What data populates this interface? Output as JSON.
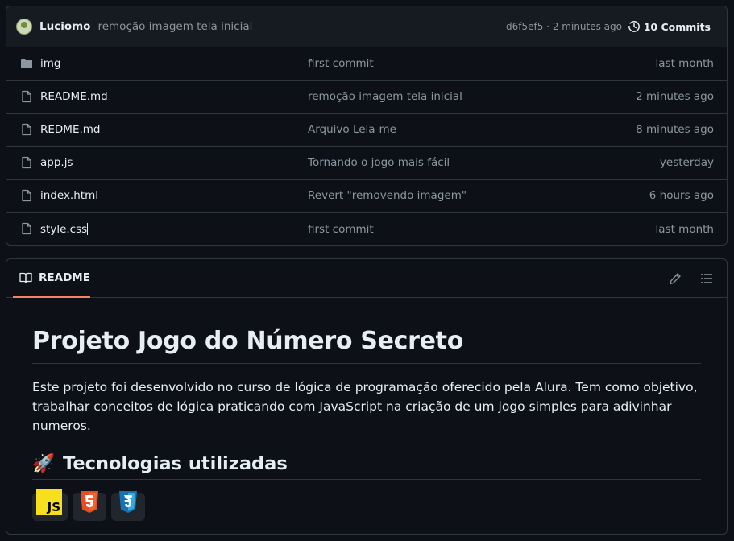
{
  "commit_bar": {
    "author": "Luciomo",
    "message": "remoção imagem tela inicial",
    "sha_time": "d6f5ef5 · 2 minutes ago",
    "commits_label": "10 Commits",
    "icons": [
      "avatar",
      "history-icon"
    ]
  },
  "files": [
    {
      "name": "img",
      "icon": "folder-icon",
      "commit": "first commit",
      "date": "last month"
    },
    {
      "name": "README.md",
      "icon": "file-icon",
      "commit": "remoção imagem tela inicial",
      "date": "2 minutes ago"
    },
    {
      "name": "REDME.md",
      "icon": "file-icon",
      "commit": "Arquivo Leia-me",
      "date": "8 minutes ago"
    },
    {
      "name": "app.js",
      "icon": "file-icon",
      "commit": "Tornando o jogo mais fácil",
      "date": "yesterday"
    },
    {
      "name": "index.html",
      "icon": "file-icon",
      "commit": "Revert \"removendo imagem\"",
      "date": "6 hours ago"
    },
    {
      "name": "style.css",
      "icon": "file-icon",
      "commit": "first commit",
      "date": "last month"
    }
  ],
  "readme": {
    "tab_label": "README",
    "title": "Projeto Jogo do Número Secreto",
    "description": "Este projeto foi desenvolvido no curso de lógica de programação oferecido pela Alura. Tem como objetivo, trabalhar conceitos de lógica praticando com JavaScript na criação de um jogo simples para adivinhar numeros.",
    "tech_heading": "Tecnologias utilizadas",
    "rocket_emoji": "🚀",
    "badges": [
      {
        "icon": "javascript-logo-icon",
        "text": "JS",
        "color": "#f7df1e"
      },
      {
        "icon": "html5-logo-icon",
        "text": "5",
        "color": "#e44d26"
      },
      {
        "icon": "css3-logo-icon",
        "text": "3",
        "color": "#1572b6"
      }
    ]
  },
  "colors": {
    "background": "#0d1117",
    "border": "#30363d",
    "muted_text": "#8d96a0",
    "tab_underline": "#f78166"
  }
}
